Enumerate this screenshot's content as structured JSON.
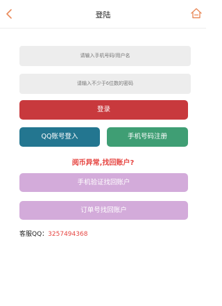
{
  "header": {
    "title": "登陆",
    "back_icon": "chevron-left-icon",
    "home_icon": "home-icon"
  },
  "form": {
    "username_placeholder": "请输入手机号码/用户名",
    "password_placeholder": "请输入不少于6位数的密码"
  },
  "buttons": {
    "login": "登录",
    "qq_login": "QQ账号登入",
    "phone_register": "手机号码注册",
    "phone_recover": "手机验证找回账户",
    "order_recover": "订单号找回账户"
  },
  "notice": "阅币异常,找回账户?",
  "support": {
    "label": "客服QQ：",
    "qq": "3257494368"
  },
  "colors": {
    "accent": "#e98a5a",
    "login": "#c8393d",
    "qq": "#237690",
    "register": "#3f9e74",
    "recover": "#d3abda",
    "notice": "#e64541"
  }
}
